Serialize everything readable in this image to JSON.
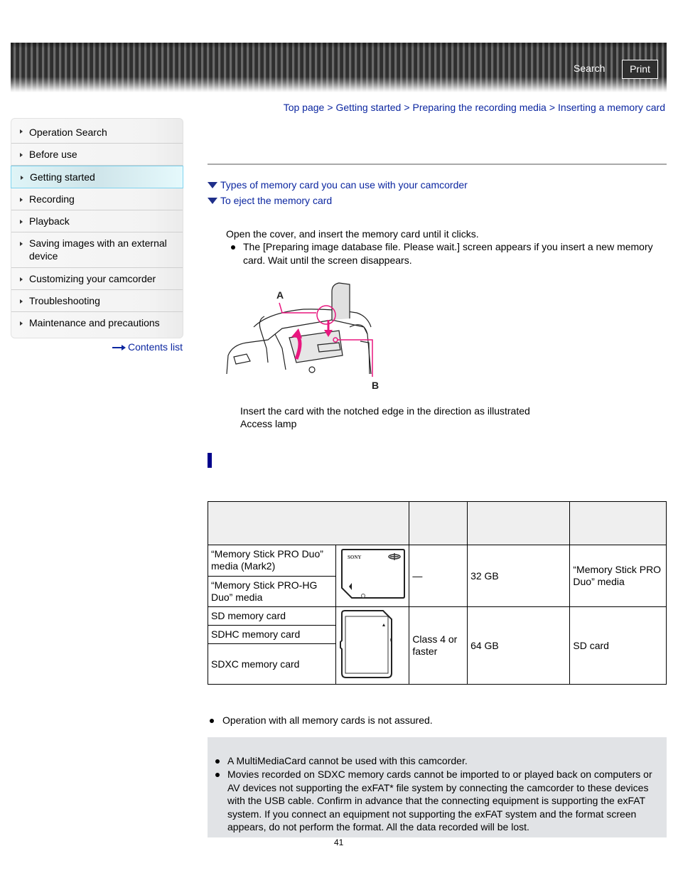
{
  "header": {
    "search_label": "Search",
    "print_label": "Print"
  },
  "sidebar": {
    "items": [
      {
        "label": "Operation Search"
      },
      {
        "label": "Before use"
      },
      {
        "label": "Getting started",
        "active": true
      },
      {
        "label": "Recording"
      },
      {
        "label": "Playback"
      },
      {
        "label": "Saving images with an external device"
      },
      {
        "label": "Customizing your camcorder"
      },
      {
        "label": "Troubleshooting"
      },
      {
        "label": "Maintenance and precautions"
      }
    ],
    "contents_link": "Contents list"
  },
  "breadcrumb": {
    "items": [
      "Top page",
      "Getting started",
      "Preparing the recording media",
      "Inserting a memory card"
    ],
    "separator": ">"
  },
  "jump_links": [
    "Types of memory card you can use with your camcorder",
    "To eject the memory card"
  ],
  "step": {
    "instruction": "Open the cover, and insert the memory card until it clicks.",
    "bullet": "The [Preparing image database file. Please wait.] screen appears if you insert a new memory card. Wait until the screen disappears."
  },
  "illustration": {
    "label_a": "A",
    "label_b": "B",
    "caption_a": "Insert the card with the notched edge in the direction as illustrated",
    "caption_b": "Access lamp",
    "accent_color": "#e8177f"
  },
  "table": {
    "header": [
      "",
      "",
      "",
      ""
    ],
    "groups": [
      {
        "names": [
          "“Memory Stick PRO Duo” media (Mark2)",
          "“Memory Stick PRO-HG Duo” media"
        ],
        "icon": "memory-stick-duo",
        "icon_brand": "SONY",
        "speed_class": "—",
        "capacity": "32 GB",
        "described_as": "“Memory Stick PRO Duo” media"
      },
      {
        "names": [
          "SD memory card",
          "SDHC memory card",
          "SDXC memory card"
        ],
        "icon": "sd-card",
        "speed_class": "Class 4 or faster",
        "capacity": "64 GB",
        "described_as": "SD card"
      }
    ]
  },
  "notes": {
    "general": "Operation with all memory cards is not assured.",
    "cautions": [
      "A MultiMediaCard cannot be used with this camcorder.",
      "Movies recorded on SDXC memory cards cannot be imported to or played back on computers or AV devices not supporting the exFAT* file system by connecting the camcorder to these devices with the USB cable. Confirm in advance that the connecting equipment is supporting the exFAT system. If you connect an equipment not supporting the exFAT system and the format screen appears, do not perform the format. All the data recorded will be lost."
    ]
  },
  "page_number": "41"
}
